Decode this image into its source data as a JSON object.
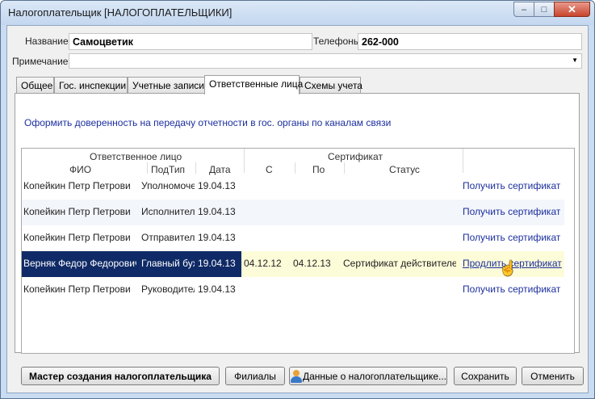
{
  "window": {
    "title": "Налогоплательщик [НАЛОГОПЛАТЕЛЬЩИКИ]",
    "min_glyph": "‒",
    "max_glyph": "□",
    "close_glyph": "✕"
  },
  "form": {
    "name_label": "Название",
    "name_value": "Самоцветик",
    "phones_label": "Телефоны",
    "phones_value": "262-000",
    "note_label": "Примечание",
    "note_value": ""
  },
  "tabs": [
    {
      "label": "Общее"
    },
    {
      "label": "Гос. инспекции"
    },
    {
      "label": "Учетные записи"
    },
    {
      "label": "Ответственные лица"
    },
    {
      "label": "Схемы учета"
    }
  ],
  "active_tab_index": 3,
  "power_of_attorney_link": "Оформить доверенность на передачу отчетности в гос. органы по каналам связи",
  "grid": {
    "group_headers": {
      "responsible": "Ответственное лицо",
      "certificate": "Сертификат"
    },
    "columns": {
      "fio": "ФИО",
      "subtype": "ПодТип",
      "date": "Дата",
      "from": "С",
      "to": "По",
      "status": "Статус"
    },
    "rows": [
      {
        "fio": "Копейкин Петр Петрович",
        "subtype": "Уполномоче",
        "date": "19.04.13",
        "from": "",
        "to": "",
        "status": "",
        "action": "Получить сертификат"
      },
      {
        "fio": "Копейкин Петр Петрович",
        "subtype": "Исполнитель",
        "date": "19.04.13",
        "from": "",
        "to": "",
        "status": "",
        "action": "Получить сертификат"
      },
      {
        "fio": "Копейкин Петр Петрович",
        "subtype": "Отправитель",
        "date": "19.04.13",
        "from": "",
        "to": "",
        "status": "",
        "action": "Получить сертификат"
      },
      {
        "fio": "Верняк Федор Федорович",
        "subtype": "Главный бух",
        "date": "19.04.13",
        "from": "04.12.12",
        "to": "04.12.13",
        "status": "Сертификат действителен.",
        "action": "Продлить сертификат"
      },
      {
        "fio": "Копейкин Петр Петрович",
        "subtype": "Руководител",
        "date": "19.04.13",
        "from": "",
        "to": "",
        "status": "",
        "action": "Получить сертификат"
      }
    ],
    "selected_row_index": 3
  },
  "buttons": {
    "wizard": "Мастер создания налогоплательщика",
    "branches": "Филиалы",
    "taxpayer_data": "Данные о налогоплательщике...",
    "save": "Сохранить",
    "cancel": "Отменить"
  },
  "colors": {
    "selection_dark": "#0f2a66",
    "selection_light": "#fdfcd9",
    "link": "#1c2f9e"
  }
}
